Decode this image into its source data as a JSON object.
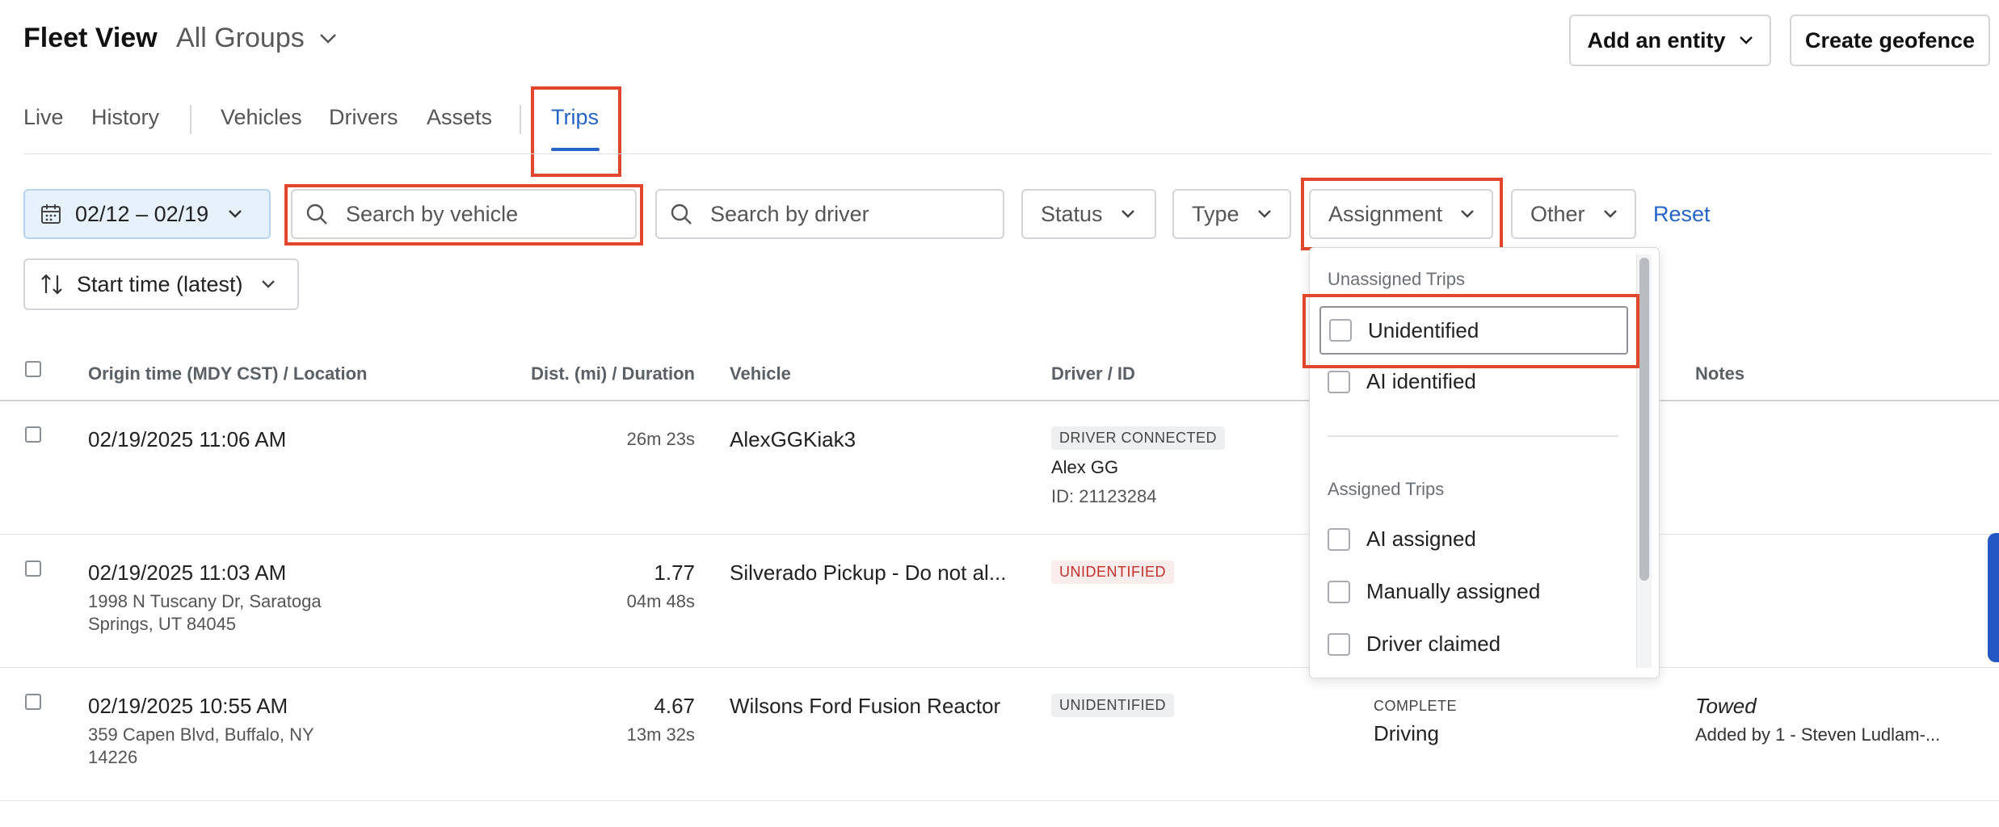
{
  "header": {
    "title": "Fleet View",
    "group_selector": "All Groups",
    "add_entity": "Add an entity",
    "create_geofence": "Create geofence"
  },
  "tabs": [
    {
      "label": "Live"
    },
    {
      "label": "History"
    },
    {
      "label": "Vehicles"
    },
    {
      "label": "Drivers"
    },
    {
      "label": "Assets"
    },
    {
      "label": "Trips"
    }
  ],
  "filters": {
    "date_range": "02/12 – 02/19",
    "search_vehicle_placeholder": "Search by vehicle",
    "search_driver_placeholder": "Search by driver",
    "status": "Status",
    "type": "Type",
    "assignment": "Assignment",
    "other": "Other",
    "reset": "Reset",
    "sort": "Start time (latest)"
  },
  "table": {
    "columns": {
      "origin": "Origin time (MDY CST) / Location",
      "distance": "Dist. (mi) / Duration",
      "vehicle": "Vehicle",
      "driver": "Driver / ID",
      "notes": "Notes"
    },
    "rows": [
      {
        "origin_time": "02/19/2025 11:06 AM",
        "distance": "",
        "duration": "26m 23s",
        "vehicle": "AlexGGKiak3",
        "driver_badge": "DRIVER CONNECTED",
        "driver_name": "Alex GG",
        "driver_id": "ID: 21123284"
      },
      {
        "origin_time": "02/19/2025 11:03 AM",
        "location_line1": "1998 N Tuscany Dr, Saratoga",
        "location_line2": "Springs, UT 84045",
        "distance": "1.77",
        "duration": "04m 48s",
        "vehicle": "Silverado Pickup - Do not al...",
        "driver_badge": "UNIDENTIFIED"
      },
      {
        "origin_time": "02/19/2025 10:55 AM",
        "location_line1": "359 Capen Blvd, Buffalo, NY",
        "location_line2": "14226",
        "distance": "4.67",
        "duration": "13m 32s",
        "vehicle": "Wilsons Ford Fusion Reactor",
        "driver_badge": "UNIDENTIFIED",
        "status_label": "COMPLETE",
        "status_value": "Driving",
        "note_title": "Towed",
        "note_author": "Added by 1 - Steven Ludlam-..."
      }
    ]
  },
  "assignment_dropdown": {
    "unassigned_header": "Unassigned Trips",
    "unassigned_options": [
      "Unidentified",
      "AI identified"
    ],
    "assigned_header": "Assigned Trips",
    "assigned_options": [
      "AI assigned",
      "Manually assigned",
      "Driver claimed"
    ]
  },
  "colors": {
    "accent": "#2563c7",
    "highlight": "#e2462c",
    "unidentified_red": "#c4302b"
  }
}
